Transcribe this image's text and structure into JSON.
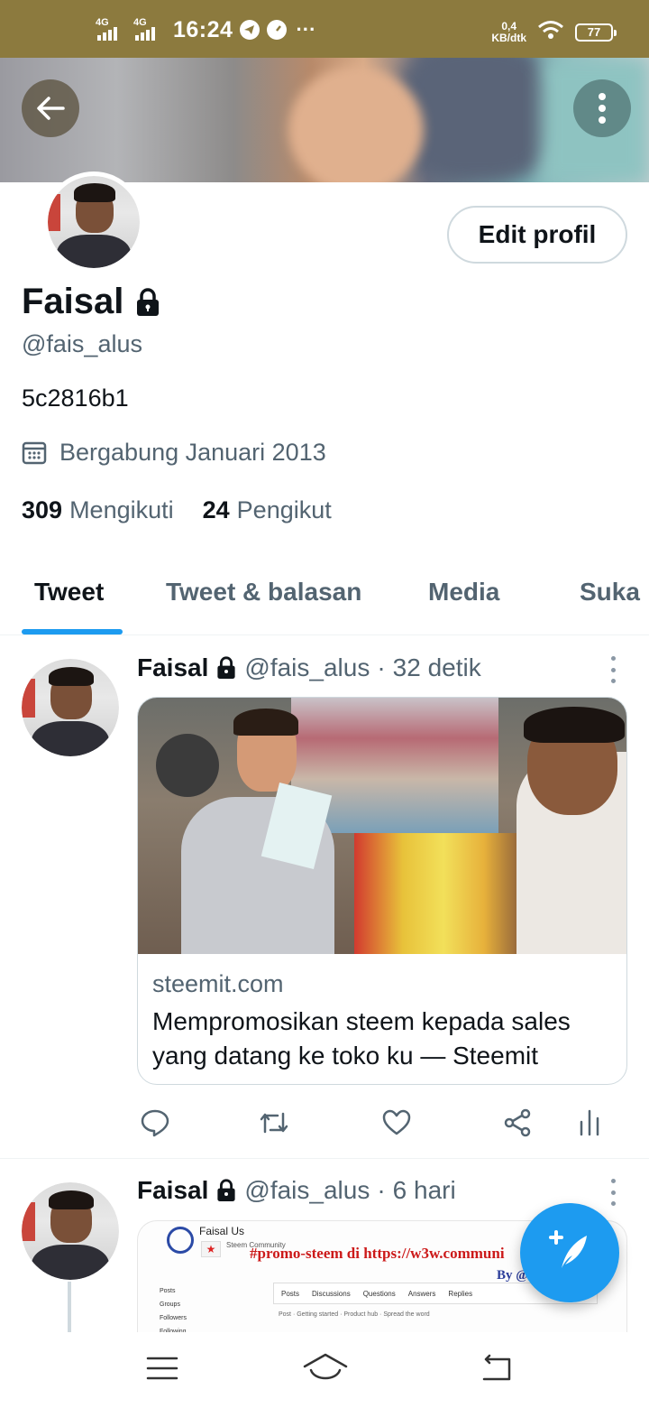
{
  "status_bar": {
    "net1": "4G",
    "net2": "4G",
    "time": "16:24",
    "dots": "···",
    "speed_value": "0,4",
    "speed_unit": "KB/dtk",
    "battery": "77"
  },
  "profile": {
    "name": "Faisal",
    "handle": "@fais_alus",
    "bio": "5c2816b1",
    "joined": "Bergabung Januari 2013",
    "following_count": "309",
    "following_label": "Mengikuti",
    "followers_count": "24",
    "followers_label": "Pengikut",
    "edit_button": "Edit profil"
  },
  "tabs": [
    {
      "label": "Tweet",
      "active": true
    },
    {
      "label": "Tweet & balasan",
      "active": false
    },
    {
      "label": "Media",
      "active": false
    },
    {
      "label": "Suka",
      "active": false
    }
  ],
  "tweets": [
    {
      "name": "Faisal",
      "handle": "@fais_alus",
      "separator": "·",
      "time": "32 detik",
      "card": {
        "domain": "steemit.com",
        "title": "Mempromosikan steem kepada sales yang datang ke toko ku — Steemit"
      }
    },
    {
      "name": "Faisal",
      "handle": "@fais_alus",
      "separator": "·",
      "time": "6 hari",
      "preview": {
        "user": "Faisal Us",
        "community": "Steem Community",
        "promo": "#promo-steem di https://w3w.communi",
        "by": "By @",
        "nav": [
          "Posts",
          "Discussions",
          "Questions",
          "Answers",
          "Replies"
        ],
        "sidebar": [
          "Posts",
          "Groups",
          "Followers",
          "Following"
        ],
        "crumb": "Post · Getting started · Product hub · Spread the word"
      }
    }
  ],
  "icons": {
    "back": "arrow-left-icon",
    "more": "more-vertical-icon",
    "lock": "lock-icon",
    "calendar": "calendar-icon",
    "reply": "reply-icon",
    "retweet": "retweet-icon",
    "like": "heart-icon",
    "share": "share-icon",
    "analytics": "analytics-icon",
    "compose": "compose-tweet-icon"
  },
  "colors": {
    "accent": "#1d9bf0",
    "status_bar": "#8c7a3e",
    "secondary_text": "#536471",
    "primary_text": "#0f1419"
  }
}
